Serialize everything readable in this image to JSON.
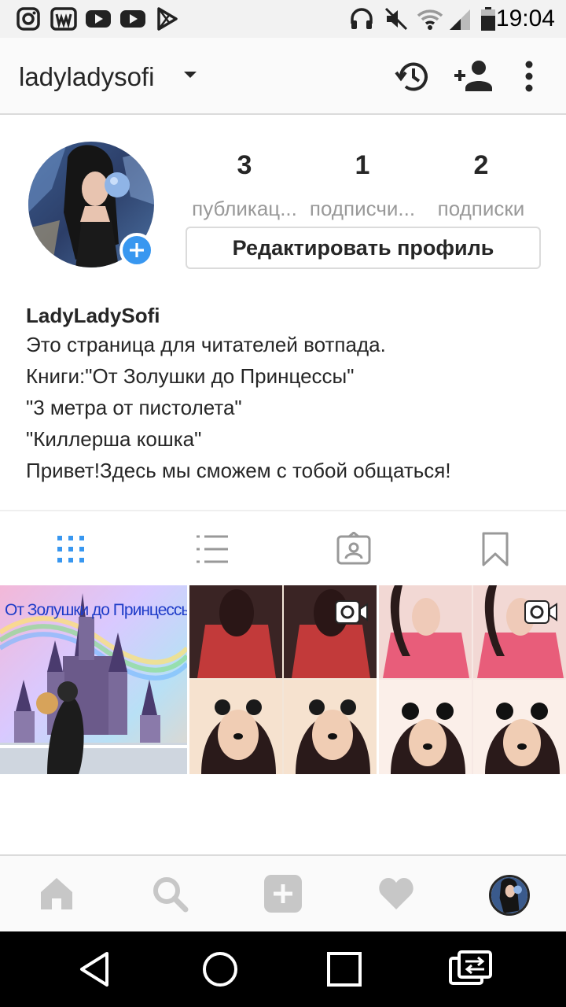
{
  "status_bar": {
    "time": "19:04",
    "icons": [
      "instagram-icon",
      "wattpad-icon",
      "youtube-icon",
      "youtube-icon",
      "play-store-icon",
      "headphones-icon",
      "mute-icon",
      "wifi-icon",
      "signal-icon",
      "battery-icon"
    ]
  },
  "header": {
    "username": "ladyladysofi",
    "icons": [
      "dropdown-caret-icon",
      "history-icon",
      "add-user-icon",
      "more-options-icon"
    ]
  },
  "profile": {
    "stats": [
      {
        "value": "3",
        "label": "публикац..."
      },
      {
        "value": "1",
        "label": "подписчи..."
      },
      {
        "value": "2",
        "label": "подписки"
      }
    ],
    "edit_button": "Редактировать профиль",
    "name": "LadyLadySofi",
    "bio_lines": [
      "Это страница для читателей вотпада.",
      "Книги:\"От Золушки до Принцессы\"",
      "\"3 метра от пистолета\"",
      "\"Киллерша кошка\"",
      "Привет!Здесь мы сможем с тобой общаться!"
    ]
  },
  "tabs": {
    "icons": [
      "grid-view-icon",
      "list-view-icon",
      "tagged-photos-icon",
      "saved-bookmark-icon"
    ],
    "active": "grid-view-icon"
  },
  "posts": [
    {
      "caption": "От Золушки до Принцессы",
      "type": "photo"
    },
    {
      "caption": "",
      "type": "video"
    },
    {
      "caption": "",
      "type": "video"
    }
  ],
  "bottom_nav": {
    "icons": [
      "home-icon",
      "search-icon",
      "add-post-icon",
      "activity-heart-icon",
      "profile-avatar"
    ]
  },
  "system_nav": {
    "icons": [
      "back-icon",
      "home-circle-icon",
      "recents-icon",
      "screen-switch-icon"
    ]
  },
  "colors": {
    "accent": "#3897f0",
    "text": "#262626",
    "secondary_text": "#999999",
    "border": "#dbdbdb"
  }
}
